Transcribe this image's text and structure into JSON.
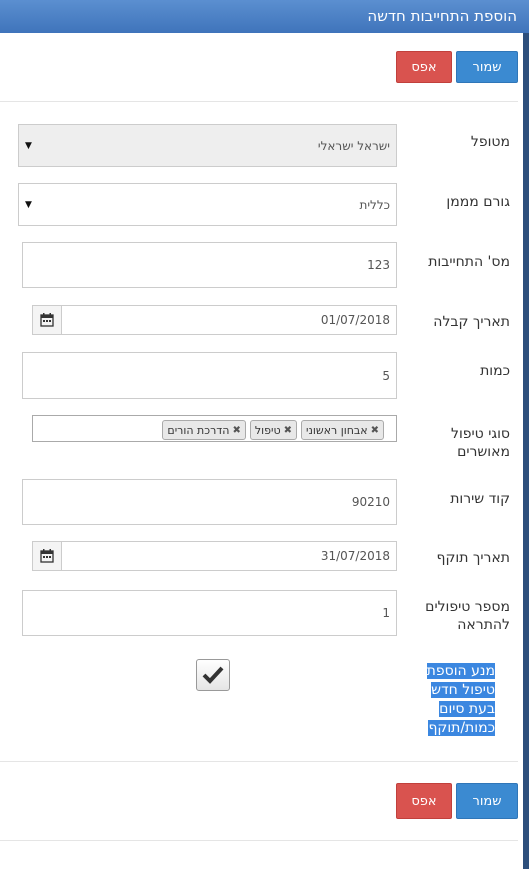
{
  "header": {
    "title": "הוספת התחייבות חדשה"
  },
  "toolbar": {
    "save_label": "שמור",
    "cancel_label": "אפס"
  },
  "form": {
    "patient": {
      "label": "מטופל",
      "value": "ישראל ישראלי"
    },
    "funder": {
      "label": "גורם מממן",
      "value": "כללית"
    },
    "commitment_number": {
      "label": "מס' התחייבות",
      "value": "123"
    },
    "receipt_date": {
      "label": "תאריך קבלה",
      "value": "01/07/2018"
    },
    "quantity": {
      "label": "כמות",
      "value": "5"
    },
    "treatment_types": {
      "label": "סוגי טיפול מאושרים",
      "tags": [
        "אבחון ראשוני",
        "טיפול",
        "הדרכת הורים"
      ]
    },
    "service_code": {
      "label": "קוד שירות",
      "value": "90210"
    },
    "expiry_date": {
      "label": "תאריך תוקף",
      "value": "31/07/2018"
    },
    "alert_treatments": {
      "label": "מספר טיפולים להתראה",
      "value": "1"
    },
    "prevent_add": {
      "label": "מנע הוספת טיפול חדש בעת סיום כמות/תוקף",
      "checked": true
    }
  },
  "footer": {
    "save_label": "שמור",
    "cancel_label": "אפס"
  }
}
